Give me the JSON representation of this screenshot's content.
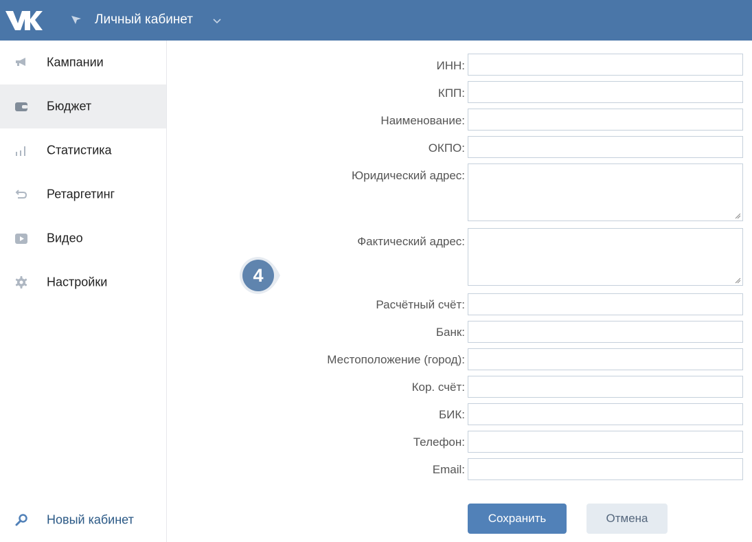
{
  "header": {
    "logo_icon": "vk-logo-icon",
    "title": "Личный кабинет",
    "background": "#4a76a8"
  },
  "sidebar": {
    "items": [
      {
        "label": "Кампании",
        "icon": "megaphone-icon",
        "active": false
      },
      {
        "label": "Бюджет",
        "icon": "wallet-icon",
        "active": true
      },
      {
        "label": "Статистика",
        "icon": "bar-chart-icon",
        "active": false
      },
      {
        "label": "Ретаргетинг",
        "icon": "return-arrow-icon",
        "active": false
      },
      {
        "label": "Видео",
        "icon": "video-play-icon",
        "active": false
      },
      {
        "label": "Настройки",
        "icon": "gear-icon",
        "active": false
      }
    ],
    "new_cabinet": {
      "label": "Новый кабинет",
      "icon": "key-icon"
    }
  },
  "step_badge": {
    "number": "4"
  },
  "form": {
    "fields": [
      {
        "label": "ИНН:",
        "value": ""
      },
      {
        "label": "КПП:",
        "value": ""
      },
      {
        "label": "Наименование:",
        "value": ""
      },
      {
        "label": "ОКПО:",
        "value": ""
      },
      {
        "label": "Юридический адрес:",
        "value": ""
      },
      {
        "label": "Фактический адрес:",
        "value": ""
      },
      {
        "label": "Расчётный счёт:",
        "value": ""
      },
      {
        "label": "Банк:",
        "value": ""
      },
      {
        "label": "Местоположение (город):",
        "value": ""
      },
      {
        "label": "Кор. счёт:",
        "value": ""
      },
      {
        "label": "БИК:",
        "value": ""
      },
      {
        "label": "Телефон:",
        "value": ""
      },
      {
        "label": "Email:",
        "value": ""
      }
    ],
    "save_label": "Сохранить",
    "cancel_label": "Отмена"
  },
  "colors": {
    "accent": "#5181b8",
    "active_nav_bg": "#edeef0",
    "link": "#2a5885"
  }
}
